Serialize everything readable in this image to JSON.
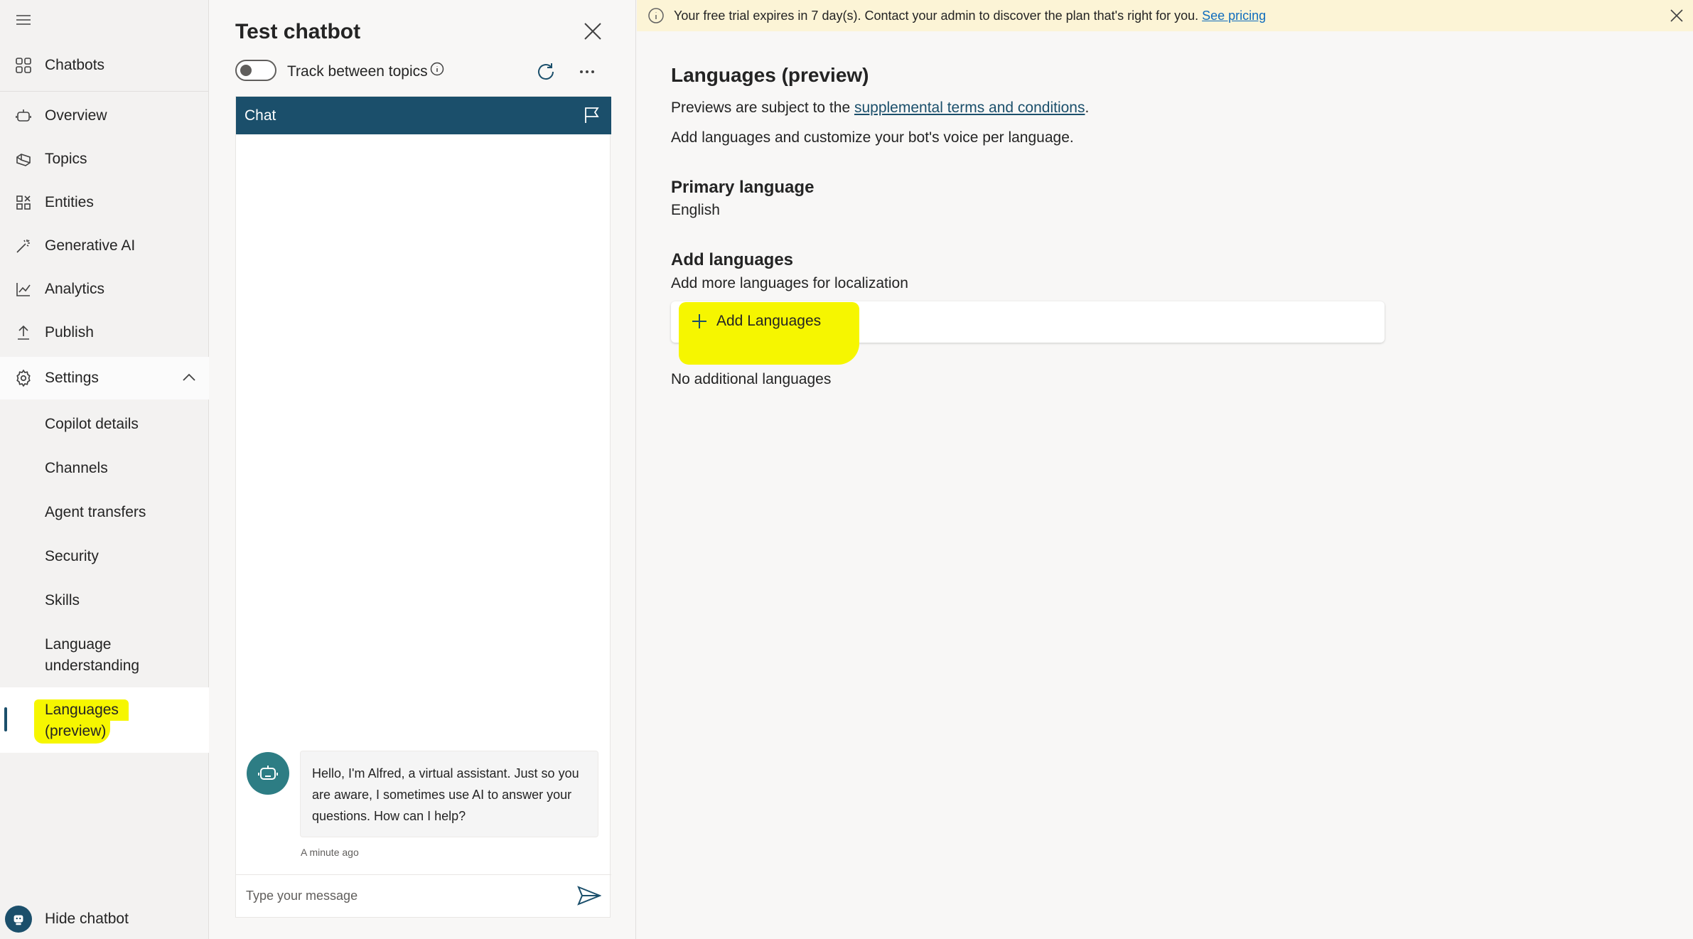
{
  "nav": {
    "chatbots": "Chatbots",
    "items": [
      {
        "label": "Overview"
      },
      {
        "label": "Topics"
      },
      {
        "label": "Entities"
      },
      {
        "label": "Generative AI"
      },
      {
        "label": "Analytics"
      },
      {
        "label": "Publish"
      },
      {
        "label": "Settings"
      }
    ],
    "sub_items": [
      {
        "label": "Copilot details"
      },
      {
        "label": "Channels"
      },
      {
        "label": "Agent transfers"
      },
      {
        "label": "Security"
      },
      {
        "label": "Skills"
      },
      {
        "label_line1": "Language",
        "label_line2": "understanding"
      },
      {
        "label_line1": "Languages",
        "label_line2": "(preview)"
      }
    ],
    "hide_chatbot": "Hide chatbot"
  },
  "test_panel": {
    "title": "Test chatbot",
    "track_label": "Track between topics",
    "chat_header": "Chat",
    "bot_message": "Hello, I'm Alfred, a virtual assistant. Just so you are aware, I sometimes use AI to answer your questions. How can I help?",
    "timestamp": "A minute ago",
    "input_placeholder": "Type your message"
  },
  "banner": {
    "text": "Your free trial expires in 7 day(s). Contact your admin to discover the plan that's right for you. ",
    "link": "See pricing"
  },
  "main": {
    "title": "Languages (preview)",
    "preview_prefix": "Previews are subject to the ",
    "preview_link": "supplemental terms and conditions",
    "preview_suffix": ".",
    "description": "Add languages and customize your bot's voice per language.",
    "primary_heading": "Primary language",
    "primary_value": "English",
    "add_heading": "Add languages",
    "add_description": "Add more languages for localization",
    "add_button": "Add Languages",
    "empty_text": "No additional languages"
  },
  "colors": {
    "accent": "#1b4f6b",
    "bot_avatar": "#2d7d84",
    "highlight": "#f6f600",
    "banner_bg": "#fcf4d6"
  }
}
